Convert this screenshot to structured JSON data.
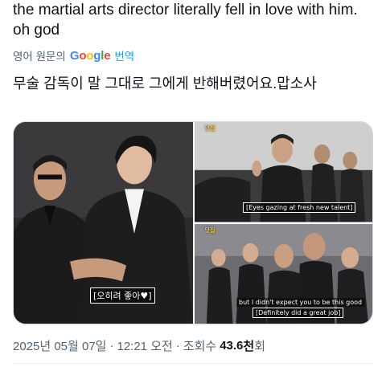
{
  "tweet": {
    "text": "the martial arts director literally fell in love with him. oh god",
    "translated_text": "무술 감독이 말 그대로 그에게 반해버렸어요.맙소사"
  },
  "translate": {
    "prefix": "영어 원문의",
    "google_letters": [
      "G",
      "o",
      "o",
      "g",
      "l",
      "e"
    ],
    "google_colors": [
      "#4285F4",
      "#EA4335",
      "#FBBC05",
      "#4285F4",
      "#34A853",
      "#EA4335"
    ],
    "action": "번역"
  },
  "media": {
    "left_caption": "[오히려 좋아♥]",
    "top_right_caption": "[Eyes gazing at fresh new talent]",
    "bottom_right_caption_line1": "but I didn't expect you to be this good",
    "bottom_right_caption_line2": "[Definitely did a great job]",
    "logo_text": "맛집"
  },
  "meta": {
    "date": "2025년 05월 07일",
    "sep": "·",
    "time": "12:21 오전",
    "views_label": "조회수",
    "views_count": "43.6",
    "views_unit": "천",
    "views_suffix": "회"
  }
}
